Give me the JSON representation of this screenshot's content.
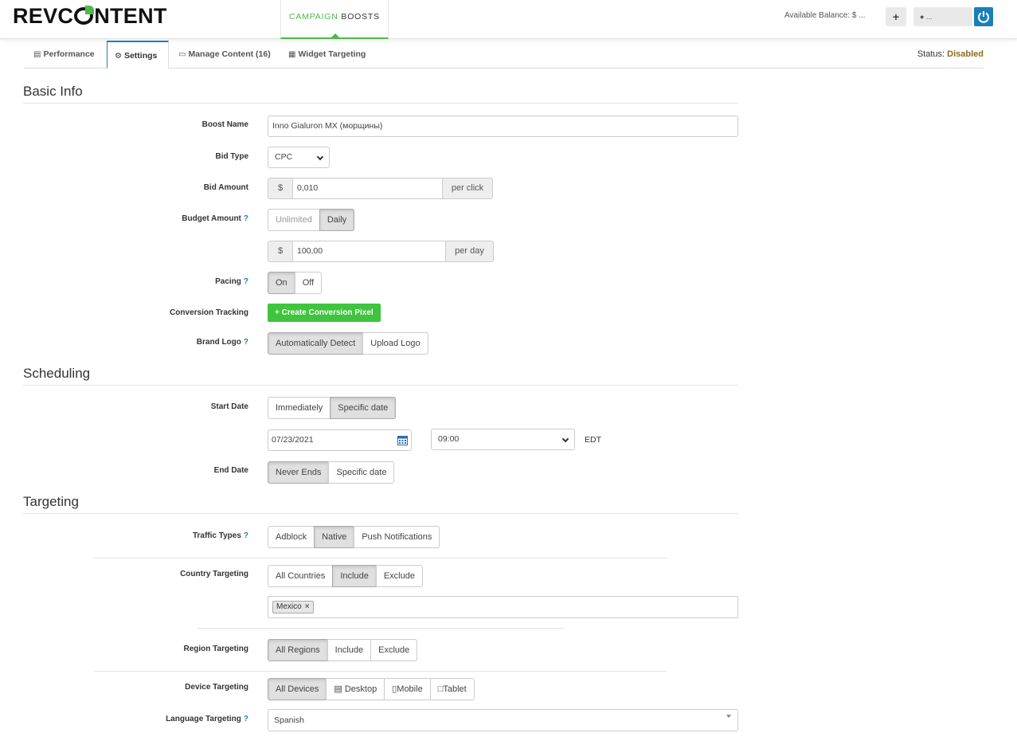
{
  "header": {
    "logo_pre": "REVC",
    "logo_post": "NTENT",
    "nav_word1": "CAMPAIGN",
    "nav_word2": "BOOSTS",
    "balance": "Available Balance: $ ...",
    "plus": "+",
    "user": "..."
  },
  "tabs": [
    {
      "label": "Performance",
      "icon": "bar-chart-icon"
    },
    {
      "label": "Settings",
      "icon": "gear-icon"
    },
    {
      "label": "Manage Content (16)",
      "icon": "file-icon"
    },
    {
      "label": "Widget Targeting",
      "icon": "grid-icon"
    }
  ],
  "status": {
    "label": "Status:",
    "value": "Disabled"
  },
  "basic_info": {
    "title": "Basic Info",
    "boost_name": {
      "label": "Boost Name",
      "value": "Inno Gialuron MX (морщины)"
    },
    "bid_type": {
      "label": "Bid Type",
      "value": "CPC"
    },
    "bid_amount": {
      "label": "Bid Amount",
      "prefix": "$",
      "value": "0,010",
      "suffix": "per click"
    },
    "budget_amount": {
      "label": "Budget Amount",
      "help": "?",
      "options": [
        "Unlimited",
        "Daily"
      ],
      "prefix": "$",
      "value": "100,00",
      "suffix": "per day"
    },
    "pacing": {
      "label": "Pacing",
      "help": "?",
      "options": [
        "On",
        "Off"
      ]
    },
    "conversion": {
      "label": "Conversion Tracking",
      "button": "+ Create Conversion Pixel"
    },
    "brand_logo": {
      "label": "Brand Logo",
      "help": "?",
      "options": [
        "Automatically Detect",
        "Upload Logo"
      ]
    }
  },
  "scheduling": {
    "title": "Scheduling",
    "start_date": {
      "label": "Start Date",
      "options": [
        "Immediately",
        "Specific date"
      ],
      "date": "07/23/2021",
      "time": "09:00",
      "tz": "EDT"
    },
    "end_date": {
      "label": "End Date",
      "options": [
        "Never Ends",
        "Specific date"
      ]
    }
  },
  "targeting": {
    "title": "Targeting",
    "traffic_types": {
      "label": "Traffic Types",
      "help": "?",
      "options": [
        "Adblock",
        "Native",
        "Push Notifications"
      ]
    },
    "country": {
      "label": "Country Targeting",
      "options": [
        "All Countries",
        "Include",
        "Exclude"
      ],
      "tag": "Mexico",
      "tag_remove": "×"
    },
    "region": {
      "label": "Region Targeting",
      "options": [
        "All Regions",
        "Include",
        "Exclude"
      ]
    },
    "device": {
      "label": "Device Targeting",
      "options": [
        "All Devices",
        "Desktop",
        "Mobile",
        "Tablet"
      ]
    },
    "language": {
      "label": "Language Targeting",
      "help": "?",
      "value": "Spanish"
    }
  },
  "colors": {
    "accent_green": "#4fb849",
    "accent_blue": "#1c7fb9",
    "button_green": "#3fc43e",
    "status_color": "#8a6d1e"
  }
}
